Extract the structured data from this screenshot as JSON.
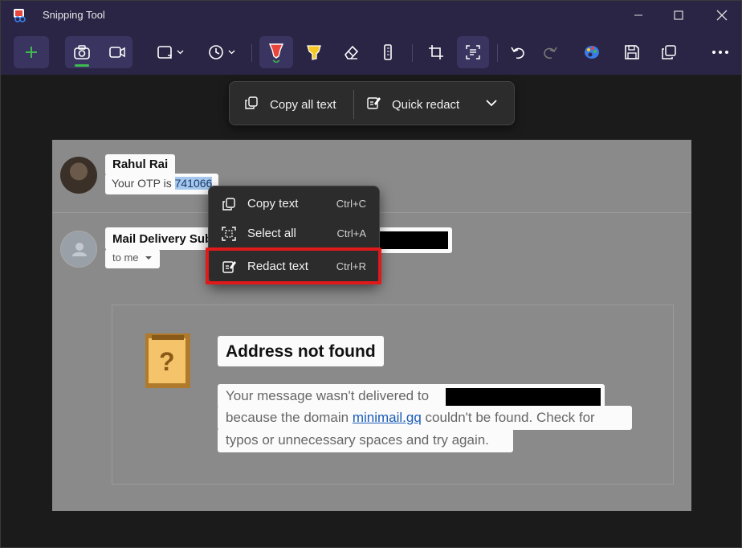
{
  "window": {
    "title": "Snipping Tool"
  },
  "toolbar": {
    "new_icon": "plus-icon",
    "mode_screenshot_icon": "camera-icon",
    "mode_video_icon": "video-icon",
    "snip_shape_icon": "rectangle-snip-icon",
    "delay_icon": "clock-icon",
    "pen_icon": "ballpoint-pen-icon",
    "highlighter_icon": "highlighter-icon",
    "eraser_icon": "eraser-icon",
    "ruler_icon": "ruler-icon",
    "crop_icon": "crop-icon",
    "text_actions_icon": "text-actions-icon",
    "undo_icon": "undo-icon",
    "redo_icon": "redo-icon",
    "paint_icon": "paint-icon",
    "save_icon": "save-icon",
    "copy_icon": "copy-icon",
    "more_icon": "more-icon"
  },
  "text_actions": {
    "copy_all": "Copy all text",
    "quick_redact": "Quick redact"
  },
  "email": {
    "sender1": "Rahul Rai",
    "otp_prefix": "Your OTP is ",
    "otp_code": "741066",
    "sender2": "Mail Delivery Subsystem",
    "to_me": "to me",
    "bounce_title": "Address not found",
    "bounce_line1": "Your message wasn't delivered to",
    "bounce_line2_pre": "because the domain ",
    "bounce_link": "minimail.gq",
    "bounce_line2_post": " couldn't be found. Check for",
    "bounce_line3": "typos or unnecessary spaces and try again."
  },
  "context_menu": {
    "items": [
      {
        "label": "Copy text",
        "shortcut": "Ctrl+C"
      },
      {
        "label": "Select all",
        "shortcut": "Ctrl+A"
      },
      {
        "label": "Redact text",
        "shortcut": "Ctrl+R"
      }
    ]
  },
  "colors": {
    "accent_green": "#3fb950",
    "highlight_red": "#e0191b",
    "titlebar": "#2a2545"
  }
}
